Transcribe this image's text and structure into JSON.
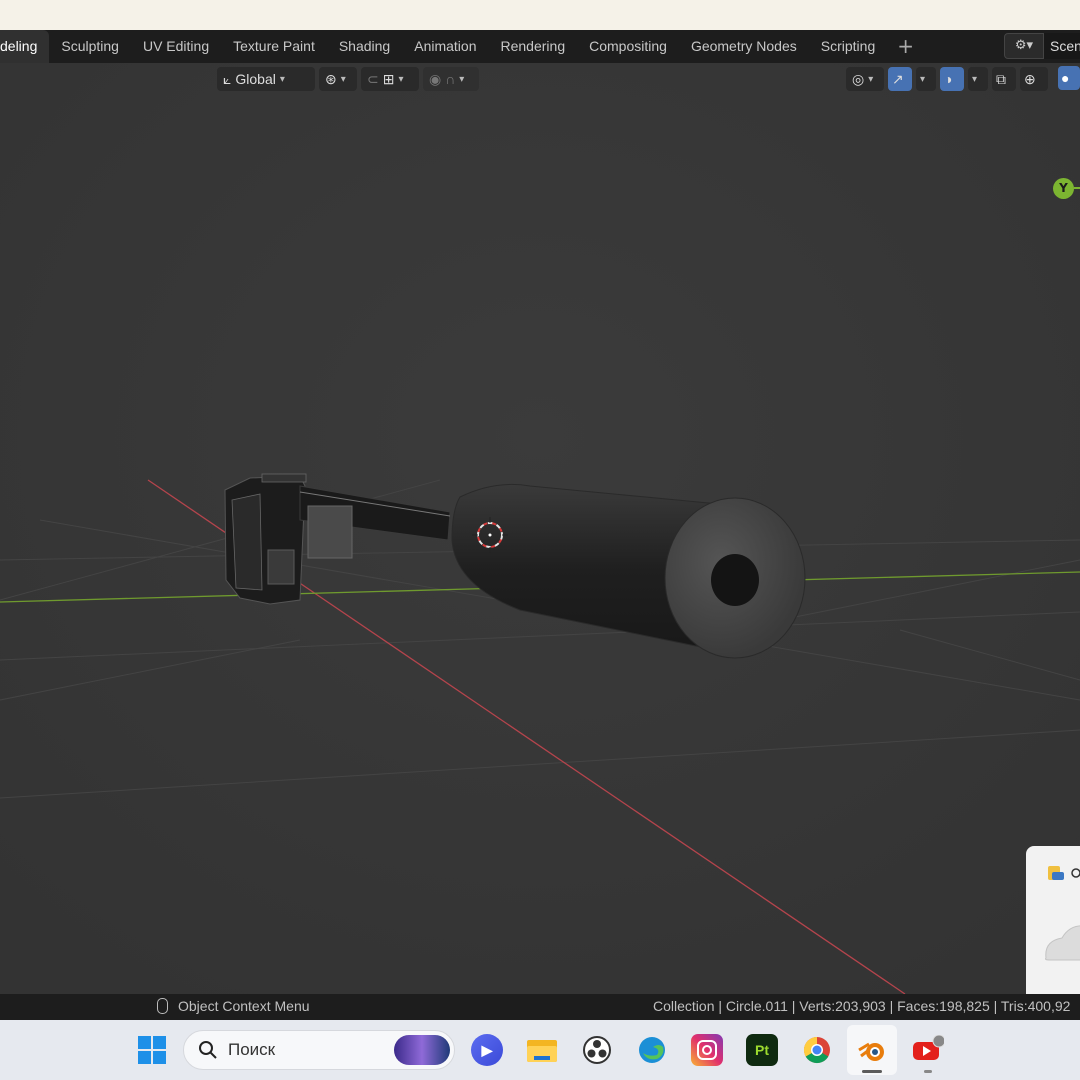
{
  "tabs": [
    {
      "label": "deling",
      "active": true
    },
    {
      "label": "Sculpting",
      "active": false
    },
    {
      "label": "UV Editing",
      "active": false
    },
    {
      "label": "Texture Paint",
      "active": false
    },
    {
      "label": "Shading",
      "active": false
    },
    {
      "label": "Animation",
      "active": false
    },
    {
      "label": "Rendering",
      "active": false
    },
    {
      "label": "Compositing",
      "active": false
    },
    {
      "label": "Geometry Nodes",
      "active": false
    },
    {
      "label": "Scripting",
      "active": false
    }
  ],
  "add_tab_label": "+",
  "scene": {
    "label": "Scen"
  },
  "header": {
    "orientation": "Global"
  },
  "gizmo": {
    "y_label": "Y"
  },
  "status": {
    "left": "Object Context Menu",
    "right": "Collection | Circle.011 | Verts:203,903 | Faces:198,825 | Tris:400,92"
  },
  "taskbar": {
    "search_placeholder": "Поиск",
    "pt_label": "Pt"
  },
  "colors": {
    "viewport_bg": "#393939",
    "x_axis": "#b4444c",
    "y_axis": "#6f9a2e",
    "selection_accent": "#4772b3"
  }
}
